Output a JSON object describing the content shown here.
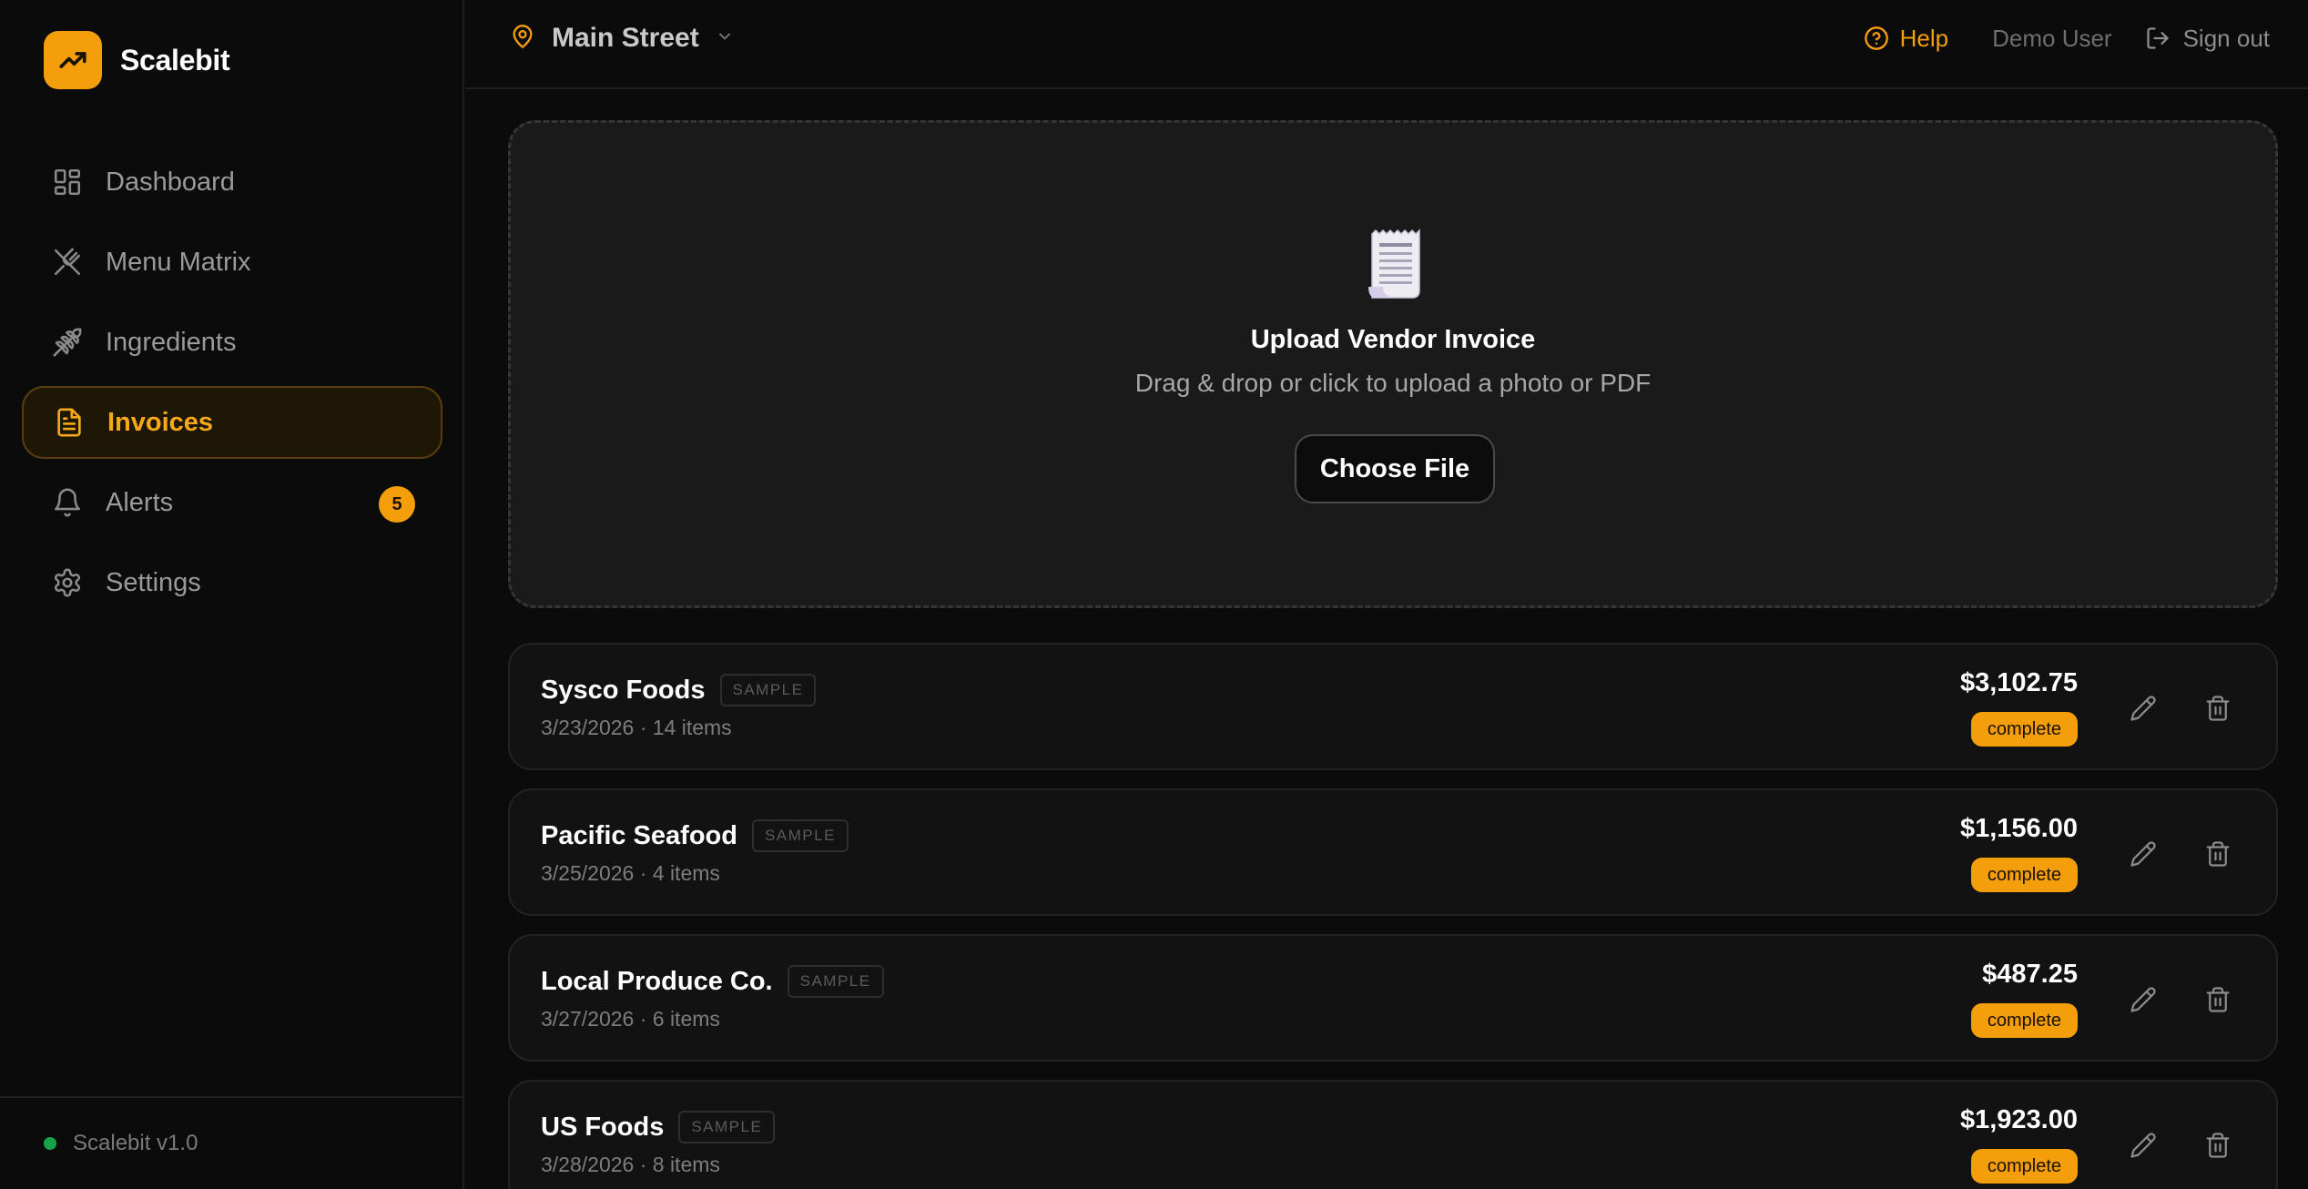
{
  "brand": {
    "name": "Scalebit",
    "accent": "#f59e0b"
  },
  "sidebar": {
    "items": [
      {
        "label": "Dashboard",
        "icon": "dashboard-icon"
      },
      {
        "label": "Menu Matrix",
        "icon": "utensils-icon"
      },
      {
        "label": "Ingredients",
        "icon": "wheat-icon"
      },
      {
        "label": "Invoices",
        "icon": "file-text-icon",
        "active": true
      },
      {
        "label": "Alerts",
        "icon": "bell-icon",
        "badge": "5"
      },
      {
        "label": "Settings",
        "icon": "gear-icon"
      }
    ],
    "footer": {
      "version": "Scalebit v1.0",
      "status_color": "#16a34a"
    }
  },
  "topbar": {
    "location": "Main Street",
    "help": "Help",
    "user": "Demo User",
    "signout": "Sign out"
  },
  "upload": {
    "icon": "receipt-icon",
    "title": "Upload Vendor Invoice",
    "subtitle": "Drag & drop or click to upload a photo or PDF",
    "button": "Choose File"
  },
  "invoices": [
    {
      "vendor": "Sysco Foods",
      "tag": "SAMPLE",
      "meta": "3/23/2026 · 14 items",
      "total": "$3,102.75",
      "status": "complete"
    },
    {
      "vendor": "Pacific Seafood",
      "tag": "SAMPLE",
      "meta": "3/25/2026 · 4 items",
      "total": "$1,156.00",
      "status": "complete"
    },
    {
      "vendor": "Local Produce Co.",
      "tag": "SAMPLE",
      "meta": "3/27/2026 · 6 items",
      "total": "$487.25",
      "status": "complete"
    },
    {
      "vendor": "US Foods",
      "tag": "SAMPLE",
      "meta": "3/28/2026 · 8 items",
      "total": "$1,923.00",
      "status": "complete"
    }
  ]
}
